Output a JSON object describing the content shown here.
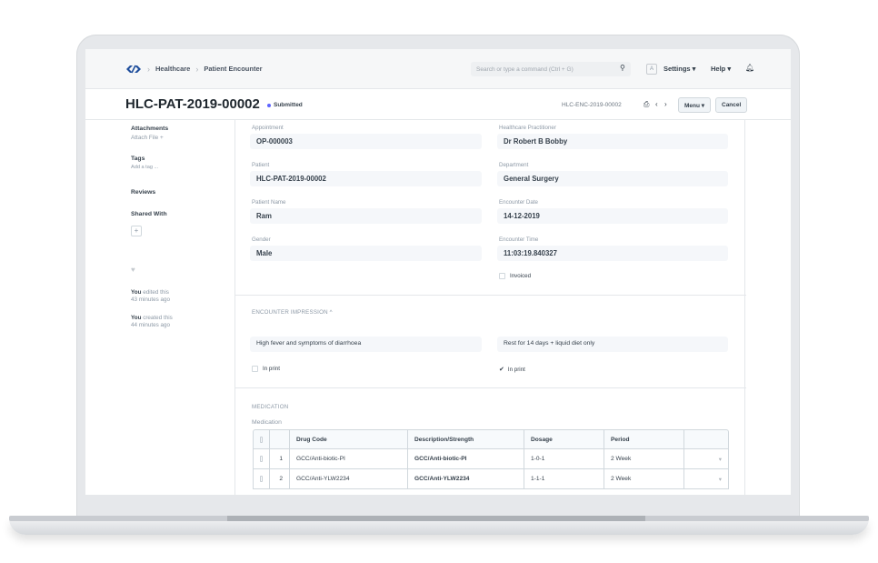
{
  "navbar": {
    "breadcrumbs": [
      "Healthcare",
      "Patient Encounter"
    ],
    "search_placeholder": "Search or type a command (Ctrl + G)",
    "avatar_letter": "A",
    "settings": "Settings ▾",
    "help": "Help ▾"
  },
  "titlebar": {
    "title": "HLC-PAT-2019-00002",
    "status": "Submitted",
    "encounter_id": "HLC-ENC-2019-00002",
    "menu_label": "Menu ▾",
    "cancel_label": "Cancel"
  },
  "sidebar": {
    "attachments": "Attachments",
    "attach_file": "Attach File +",
    "tags": "Tags",
    "add_tag": "Add a tag ...",
    "reviews": "Reviews",
    "shared_with": "Shared With",
    "plus": "+",
    "activity": [
      {
        "who": "You",
        "what": "edited this",
        "when": "43 minutes ago"
      },
      {
        "who": "You",
        "what": "created this",
        "when": "44 minutes ago"
      }
    ]
  },
  "form": {
    "appointment_label": "Appointment",
    "appointment": "OP-000003",
    "practitioner_label": "Healthcare Practitioner",
    "practitioner": "Dr Robert B Bobby",
    "patient_label": "Patient",
    "patient": "HLC-PAT-2019-00002",
    "department_label": "Department",
    "department": "General Surgery",
    "patient_name_label": "Patient Name",
    "patient_name": "Ram",
    "encounter_date_label": "Encounter Date",
    "encounter_date": "14-12-2019",
    "gender_label": "Gender",
    "gender": "Male",
    "encounter_time_label": "Encounter Time",
    "encounter_time": "11:03:19.840327",
    "invoiced_label": "Invoiced"
  },
  "impression": {
    "section_label": "ENCOUNTER IMPRESSION  ^",
    "symptoms": "High fever and symptoms of diarrhoea",
    "plan": "Rest for 14 days + liquid diet only",
    "in_print_left": "In print",
    "in_print_right": "In print"
  },
  "medication": {
    "section_label": "MEDICATION",
    "table_label": "Medication",
    "columns": [
      "Drug Code",
      "Description/Strength",
      "Dosage",
      "Period"
    ],
    "rows": [
      {
        "idx": "1",
        "drug_code": "GCC/Anti-biotic-PI",
        "description": "GCC/Anti-biotic-PI",
        "dosage": "1-0-1",
        "period": "2 Week"
      },
      {
        "idx": "2",
        "drug_code": "GCC/Anti-YLW2234",
        "description": "GCC/Anti-YLW2234",
        "dosage": "1-1-1",
        "period": "2 Week"
      }
    ]
  }
}
